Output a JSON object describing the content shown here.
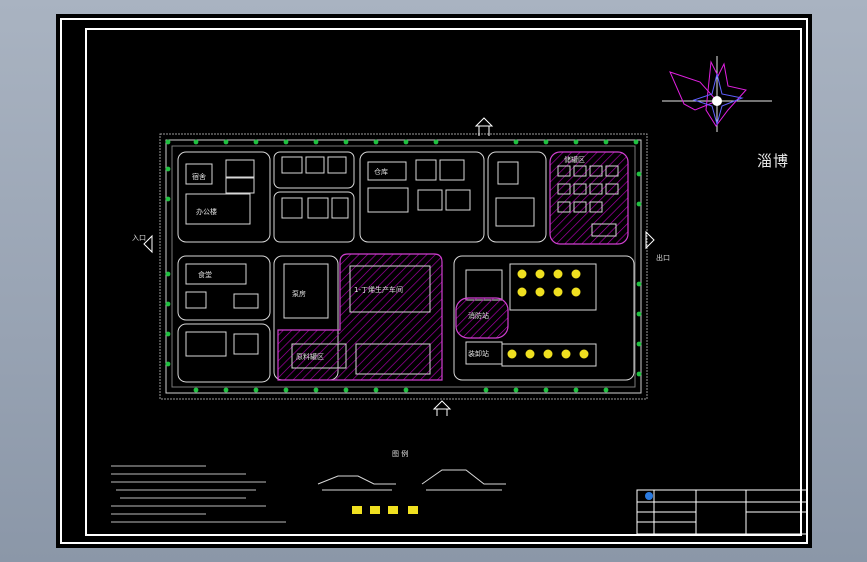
{
  "drawing": {
    "city_label": "淄博",
    "entrance_labels": [
      "入口",
      "出口"
    ],
    "legend_title": "图 例"
  },
  "buildings": [
    {
      "id": "b-office",
      "label": "办公楼"
    },
    {
      "id": "b-dormitory",
      "label": "宿舍"
    },
    {
      "id": "b-canteen",
      "label": "食堂"
    },
    {
      "id": "b-warehouse-1",
      "label": "仓库"
    },
    {
      "id": "b-butadiene",
      "label": "1-丁烯生产车间"
    },
    {
      "id": "b-storage",
      "label": "原料罐区"
    },
    {
      "id": "b-tank-farm",
      "label": "储罐区"
    },
    {
      "id": "b-fire-station",
      "label": "消防站"
    },
    {
      "id": "b-pump",
      "label": "泵房"
    },
    {
      "id": "b-loading",
      "label": "装卸站"
    }
  ],
  "colors": {
    "background": "#000000",
    "border": "#ffffff",
    "hatch": "#b000b0",
    "trees": "#20c040",
    "lines": "#d8d8d8",
    "tanks": "#f0e020"
  }
}
